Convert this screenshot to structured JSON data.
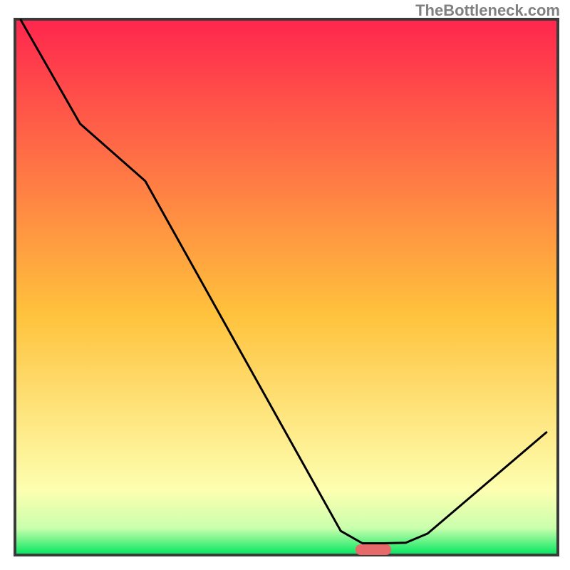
{
  "credit_text": "TheBottleneck.com",
  "chart_data": {
    "type": "line",
    "title": "",
    "xlabel": "",
    "ylabel": "",
    "xlim": [
      0,
      100
    ],
    "ylim": [
      0,
      100
    ],
    "x": [
      1,
      12,
      24,
      60,
      64,
      68,
      72,
      76,
      98
    ],
    "values": [
      100,
      80.5,
      69.8,
      4.5,
      2.2,
      2.2,
      2.3,
      4.0,
      23.0
    ],
    "marker": {
      "x": 66,
      "y": 1.0,
      "color": "#e76a6a"
    },
    "colors": {
      "gradient_top": "#ff264e",
      "gradient_mid": "#ffc23c",
      "gradient_low": "#fdffb0",
      "gradient_bottom": "#00e55e",
      "line": "#000000",
      "axis": "#3a3a3a"
    }
  }
}
